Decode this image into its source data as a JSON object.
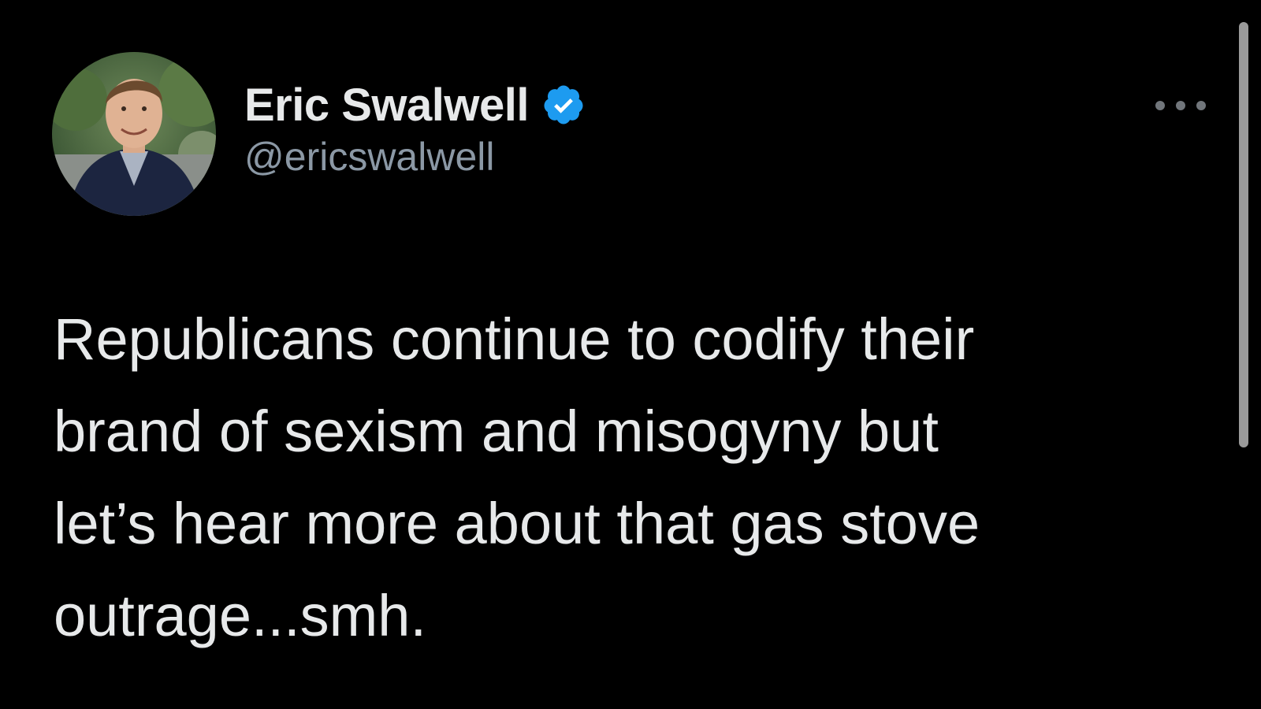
{
  "tweet": {
    "author": {
      "display_name": "Eric Swalwell",
      "handle": "@ericswalwell",
      "verified": true,
      "avatar_icon": "profile-photo"
    },
    "text": "Republicans continue to codify their\nbrand of sexism and misogyny but\nlet’s hear more about that gas stove\noutrage...smh.",
    "more_icon": "more-horizontal-icon"
  },
  "colors": {
    "background": "#000000",
    "text_primary": "#e7e9ea",
    "text_secondary": "#8b98a5",
    "verified_blue": "#1d9bf0",
    "scrollbar": "#9a9a9a"
  }
}
